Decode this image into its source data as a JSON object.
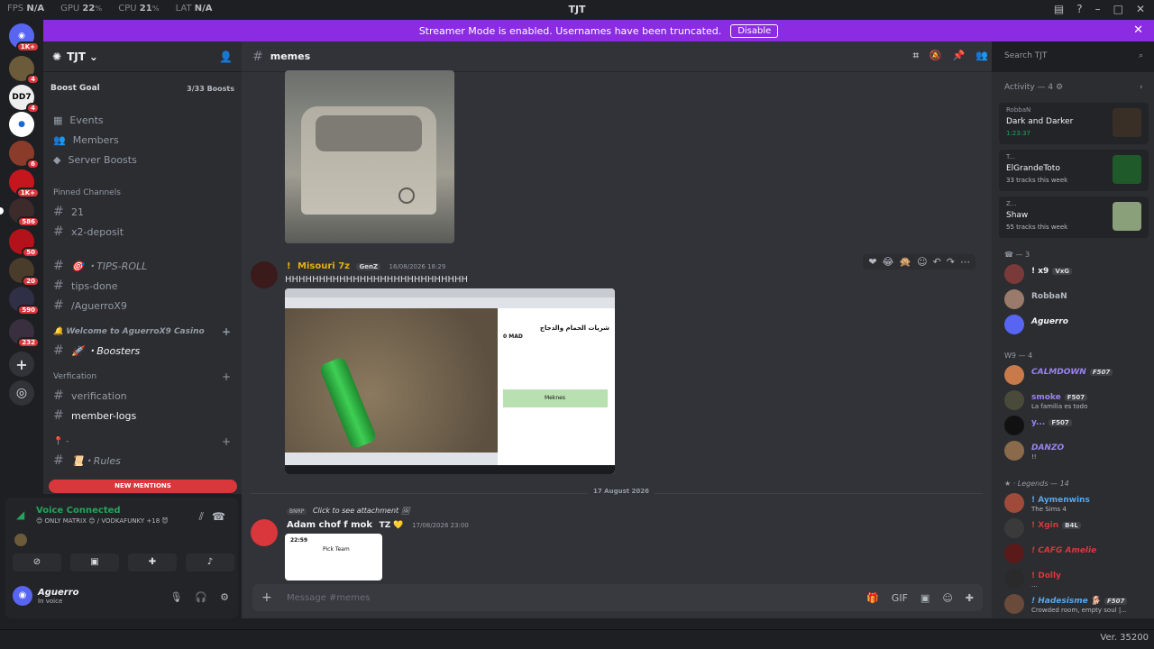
{
  "titlebar": {
    "fps_label": "FPS",
    "fps_value": "N/A",
    "gpu_label": "GPU",
    "gpu_value": "22",
    "cpu_label": "CPU",
    "cpu_value": "21",
    "lat_label": "LAT",
    "lat_value": "N/A",
    "title": "TJT"
  },
  "banner": {
    "text": "Streamer Mode is enabled. Usernames have been truncated.",
    "button": "Disable"
  },
  "guilds": [
    {
      "badge": "1K+"
    },
    {
      "badge": "4"
    },
    {
      "badge": "4"
    },
    {
      "badge": ""
    },
    {
      "badge": "6"
    },
    {
      "badge": "1K+"
    },
    {
      "badge": "586"
    },
    {
      "badge": "50"
    },
    {
      "badge": "20"
    },
    {
      "badge": "590"
    },
    {
      "badge": "232"
    }
  ],
  "server": {
    "name": "TJT",
    "boost_goal": "Boost Goal",
    "boost_progress": "3/33 Boosts"
  },
  "sidebar": {
    "top": [
      "Events",
      "Members",
      "Server Boosts"
    ],
    "pinned_header": "Pinned Channels",
    "pinned": [
      "21",
      "x2-deposit"
    ],
    "tips": [
      "🎯 ・TIPS-ROLL",
      "tips-done",
      "/AguerroX9"
    ],
    "casino_header": "🔔 Welcome to AguerroX9 Casino",
    "casino": [
      "🚀 ・Boosters"
    ],
    "verif_header": "Verfication",
    "verif": [
      "verification",
      "member-logs"
    ],
    "rules_header": "📍 -",
    "rules": [
      "📜・Rules"
    ],
    "new_mentions": "NEW MENTIONS"
  },
  "voice": {
    "title": "Voice Connected",
    "channel": "😊 ONLY MATRIX 😊 / VODKAFUNKY +18 😈"
  },
  "account": {
    "name": "Aguerro",
    "status": "In voice"
  },
  "channel": {
    "name": "memes"
  },
  "messages": {
    "m1_prefix": "!",
    "m1_name": "Misouri 7z",
    "m1_tag": "GenZ",
    "m1_time": "16/08/2026 18:29",
    "m1_text": "HHHHHHHHHHHHHHHHHHHHHHHHHHH",
    "shot_price": "0 MAD",
    "shot_title": "شريات الحمام والدجاج",
    "shot_loc": "Meknes",
    "date_divider": "17 August 2026",
    "m2_reply_tag": "BNRP",
    "m2_reply_text": "Click to see attachment",
    "m2_name": "Adam chof f mok",
    "m2_tag": "TZ 💛",
    "m2_time": "17/08/2026 23:00",
    "phone_time": "22:59",
    "phone_title": "Pick Team"
  },
  "input": {
    "placeholder": "Message #memes"
  },
  "search": {
    "placeholder": "Search TJT"
  },
  "activity": {
    "header": "Activity — 4",
    "cards": [
      {
        "user": "RobbaN",
        "game": "Dark and Darker",
        "detail": "1:23:37"
      },
      {
        "user": "T...",
        "game": "ElGrandeToto",
        "detail": "33 tracks this week"
      },
      {
        "user": "Z...",
        "game": "Shaw",
        "detail": "55 tracks this week"
      }
    ]
  },
  "member_groups": [
    {
      "header": "☎ — 3",
      "members": [
        {
          "name": "! x9",
          "tag": "VxG",
          "sub": ""
        },
        {
          "name": "RobbaN",
          "tag": "",
          "sub": ""
        },
        {
          "name": "Aguerro",
          "tag": "",
          "sub": ""
        }
      ]
    },
    {
      "header": "W9 — 4",
      "members": [
        {
          "name": "CALMDOWN",
          "tag": "F507",
          "sub": ""
        },
        {
          "name": "smoke",
          "tag": "F507",
          "sub": "La familia es todo"
        },
        {
          "name": "y...",
          "tag": "F507",
          "sub": ""
        },
        {
          "name": "DANZO",
          "tag": "",
          "sub": "!!"
        }
      ]
    },
    {
      "header": "★ · Legends — 14",
      "members": [
        {
          "name": "! Aymenwins",
          "tag": "",
          "sub": "The Sims 4"
        },
        {
          "name": "! Xgin",
          "tag": "B4L",
          "sub": ""
        },
        {
          "name": "! CAFG Amelie",
          "tag": "",
          "sub": ""
        },
        {
          "name": "! Dolly",
          "tag": "",
          "sub": "..."
        },
        {
          "name": "! Hadesisme 🐕",
          "tag": "F507",
          "sub": "Crowded room, empty soul |..."
        }
      ]
    }
  ],
  "footer": {
    "version": "Ver. 35200"
  }
}
